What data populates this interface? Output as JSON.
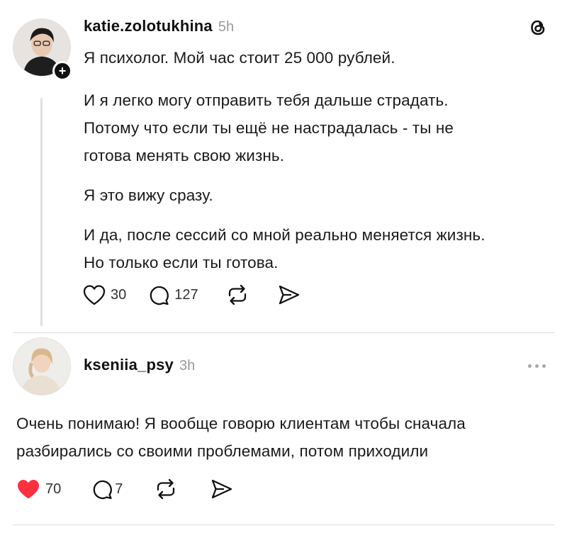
{
  "post": {
    "username": "katie.zolotukhina",
    "time": "5h",
    "paragraphs": [
      [
        "Я психолог. Мой час стоит 25 000 рублей."
      ],
      [
        "И я легко могу отправить тебя дальше страдать.",
        "Потому что если ты ещё не настрадалась - ты не",
        "готова менять свою жизнь."
      ],
      [
        "Я это вижу сразу."
      ],
      [
        "И да, после сессий со мной реально меняется жизнь.",
        "Но только если ты готова."
      ]
    ],
    "likes": "30",
    "replies": "127"
  },
  "reply": {
    "username": "kseniia_psy",
    "time": "3h",
    "lines": [
      "Очень понимаю! Я вообще говорю клиентам чтобы сначала",
      "разбирались со своими проблемами, потом приходили"
    ],
    "likes": "70",
    "replies": "7"
  },
  "colors": {
    "like_active": "#ff3040",
    "text": "#1a1a1a",
    "muted": "#9a9a9a"
  },
  "icons": [
    "threads-logo-icon",
    "heart-icon",
    "comment-icon",
    "repost-icon",
    "share-icon",
    "more-icon",
    "plus-icon"
  ]
}
